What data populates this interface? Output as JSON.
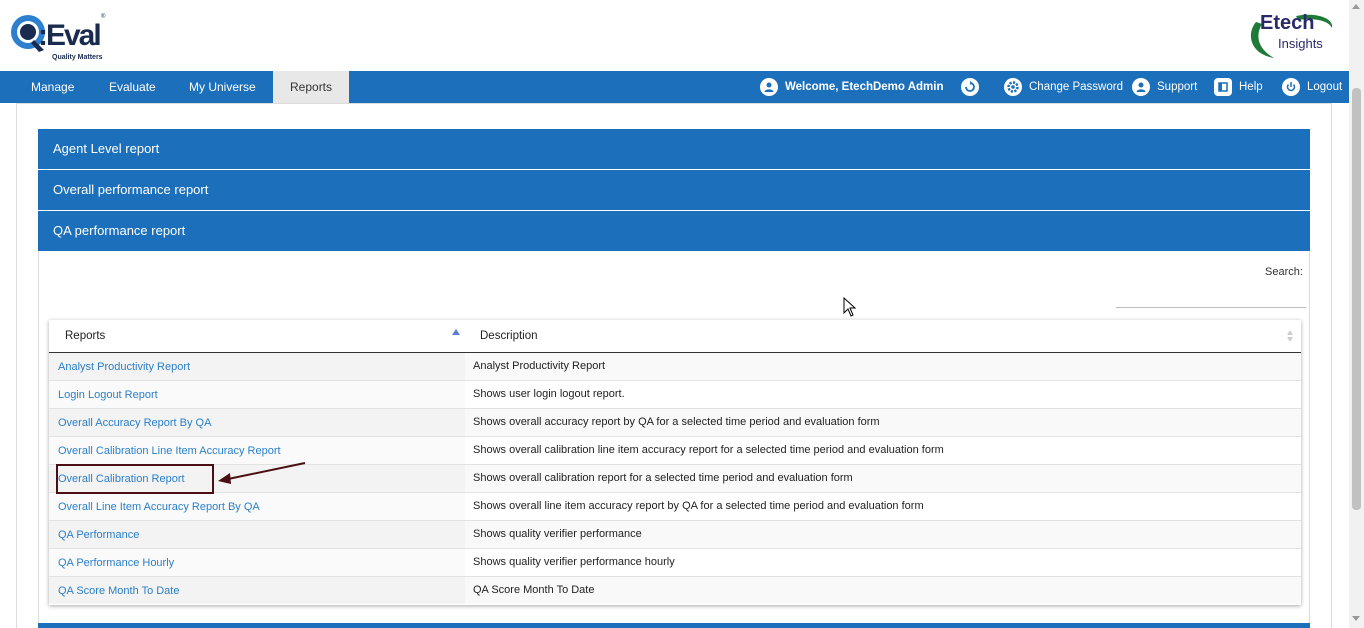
{
  "header": {
    "logo_left": {
      "text": "QEval",
      "tagline": "Quality Matters"
    },
    "logo_right": {
      "line1": "Etech",
      "line2": "Insights"
    }
  },
  "nav": {
    "items": [
      {
        "label": "Manage",
        "active": false
      },
      {
        "label": "Evaluate",
        "active": false
      },
      {
        "label": "My Universe",
        "active": false
      },
      {
        "label": "Reports",
        "active": true
      }
    ],
    "right": {
      "welcome": "Welcome, EtechDemo Admin",
      "change_password": "Change Password",
      "support": "Support",
      "help": "Help",
      "logout": "Logout"
    }
  },
  "accordion": {
    "items": [
      "Agent Level report",
      "Overall performance report",
      "QA performance report"
    ]
  },
  "search": {
    "label": "Search:",
    "value": ""
  },
  "table": {
    "columns": [
      "Reports",
      "Description"
    ],
    "rows": [
      {
        "report": "Analyst Productivity Report",
        "description": "Analyst Productivity Report"
      },
      {
        "report": "Login Logout Report",
        "description": "Shows user login logout report."
      },
      {
        "report": "Overall Accuracy Report By QA",
        "description": "Shows overall accuracy report by QA for a selected time period and evaluation form"
      },
      {
        "report": "Overall Calibration Line Item Accuracy Report",
        "description": "Shows overall calibration line item accuracy report for a selected time period and evaluation form"
      },
      {
        "report": "Overall Calibration Report",
        "description": "Shows overall calibration report for a selected time period and evaluation form"
      },
      {
        "report": "Overall Line Item Accuracy Report By QA",
        "description": "Shows overall line item accuracy report by QA for a selected time period and evaluation form"
      },
      {
        "report": "QA Performance",
        "description": "Shows quality verifier performance"
      },
      {
        "report": "QA Performance Hourly",
        "description": "Shows quality verifier performance hourly"
      },
      {
        "report": "QA Score Month To Date",
        "description": "QA Score Month To Date"
      }
    ]
  },
  "colors": {
    "primary": "#1c6fba",
    "link": "#2a7fc9",
    "highlight_annotation": "#4a0f14"
  }
}
